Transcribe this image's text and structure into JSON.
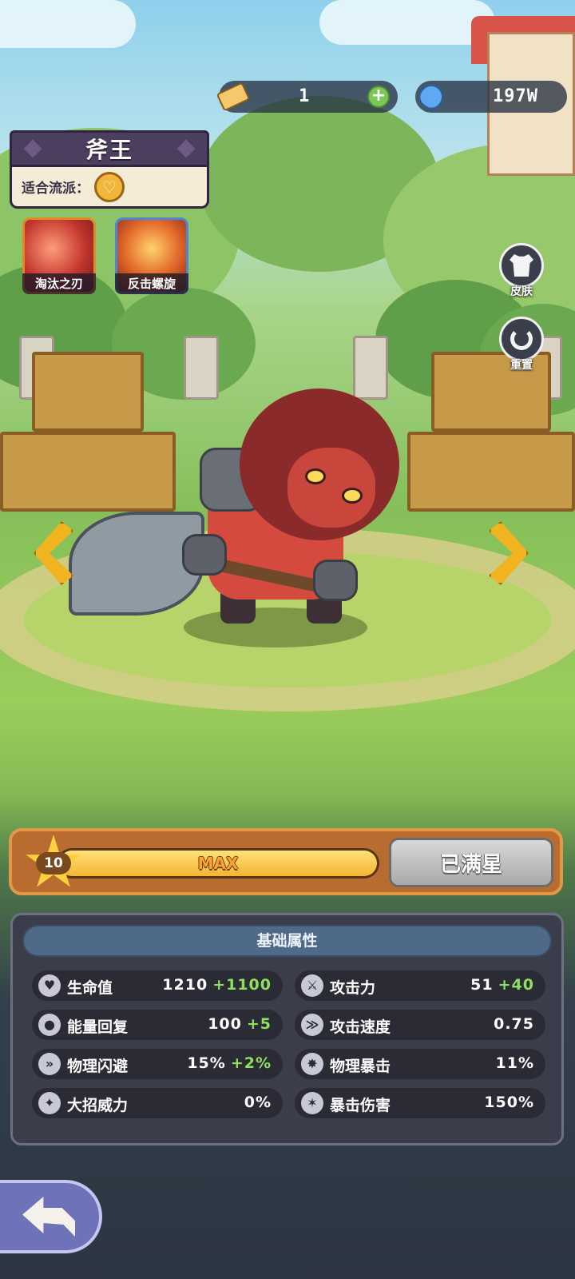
{
  "resources": {
    "tickets": "1",
    "gems": "197W",
    "plus_symbol": "+"
  },
  "hero": {
    "name": "斧王",
    "school_label": "适合流派：",
    "school_icon": "heart-icon"
  },
  "skills": [
    {
      "label": "淘汰之刃",
      "icon": "blade-skill-icon"
    },
    {
      "label": "反击螺旋",
      "icon": "spiral-skill-icon"
    }
  ],
  "side_buttons": {
    "skin": "皮肤",
    "reset": "重置"
  },
  "level": {
    "stars": "10",
    "progress_text": "MAX",
    "progress_fraction": 1.0,
    "maxed_button": "已满星"
  },
  "stats": {
    "header": "基础属性",
    "left": [
      {
        "name": "生命值",
        "value": "1210",
        "bonus": "+1100",
        "icon": "heart-icon"
      },
      {
        "name": "能量回复",
        "value": "100",
        "bonus": "+5",
        "icon": "energy-drop-icon"
      },
      {
        "name": "物理闪避",
        "value": "15%",
        "bonus": "+2%",
        "icon": "dodge-icon"
      },
      {
        "name": "大招威力",
        "value": "0%",
        "bonus": "",
        "icon": "ultimate-icon"
      }
    ],
    "right": [
      {
        "name": "攻击力",
        "value": "51",
        "bonus": "+40",
        "icon": "sword-icon"
      },
      {
        "name": "攻击速度",
        "value": "0.75",
        "bonus": "",
        "icon": "attack-speed-icon"
      },
      {
        "name": "物理暴击",
        "value": "11%",
        "bonus": "",
        "icon": "crit-icon"
      },
      {
        "name": "暴击伤害",
        "value": "150%",
        "bonus": "",
        "icon": "crit-damage-icon"
      }
    ]
  },
  "colors": {
    "accent_orange": "#e29945",
    "bonus_green": "#8fe05d",
    "stats_header": "#4f6a89"
  }
}
